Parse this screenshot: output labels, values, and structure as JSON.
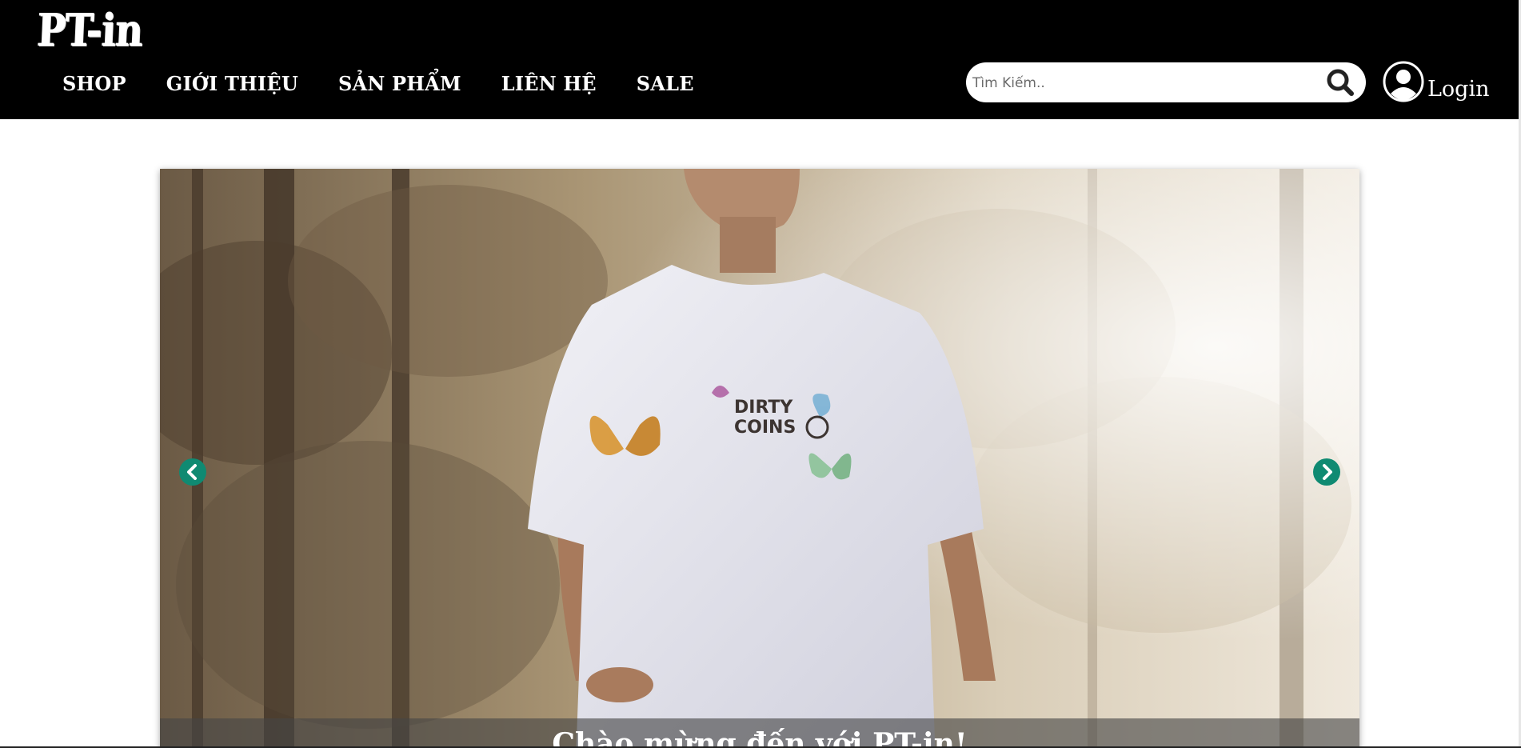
{
  "header": {
    "logo": "PT-in",
    "nav": [
      {
        "label": "SHOP"
      },
      {
        "label": "GIỚI THIỆU"
      },
      {
        "label": "SẢN PHẨM"
      },
      {
        "label": "LIÊN HỆ"
      },
      {
        "label": "SALE"
      }
    ],
    "search": {
      "placeholder": "Tìm Kiếm..",
      "value": "",
      "icon": "search-icon"
    },
    "login": {
      "label": "Login",
      "icon": "user-circle-icon"
    }
  },
  "slider": {
    "caption": "Chào mừng đến với PT-in!",
    "prev_icon": "chevron-left-circle-icon",
    "next_icon": "chevron-right-circle-icon",
    "shirt_print": "DIRTY COINS"
  },
  "colors": {
    "header_bg": "#000000",
    "nav_text": "#ffffff",
    "arrow_bg": "#0f8a72",
    "page_bg": "#ffffff"
  }
}
